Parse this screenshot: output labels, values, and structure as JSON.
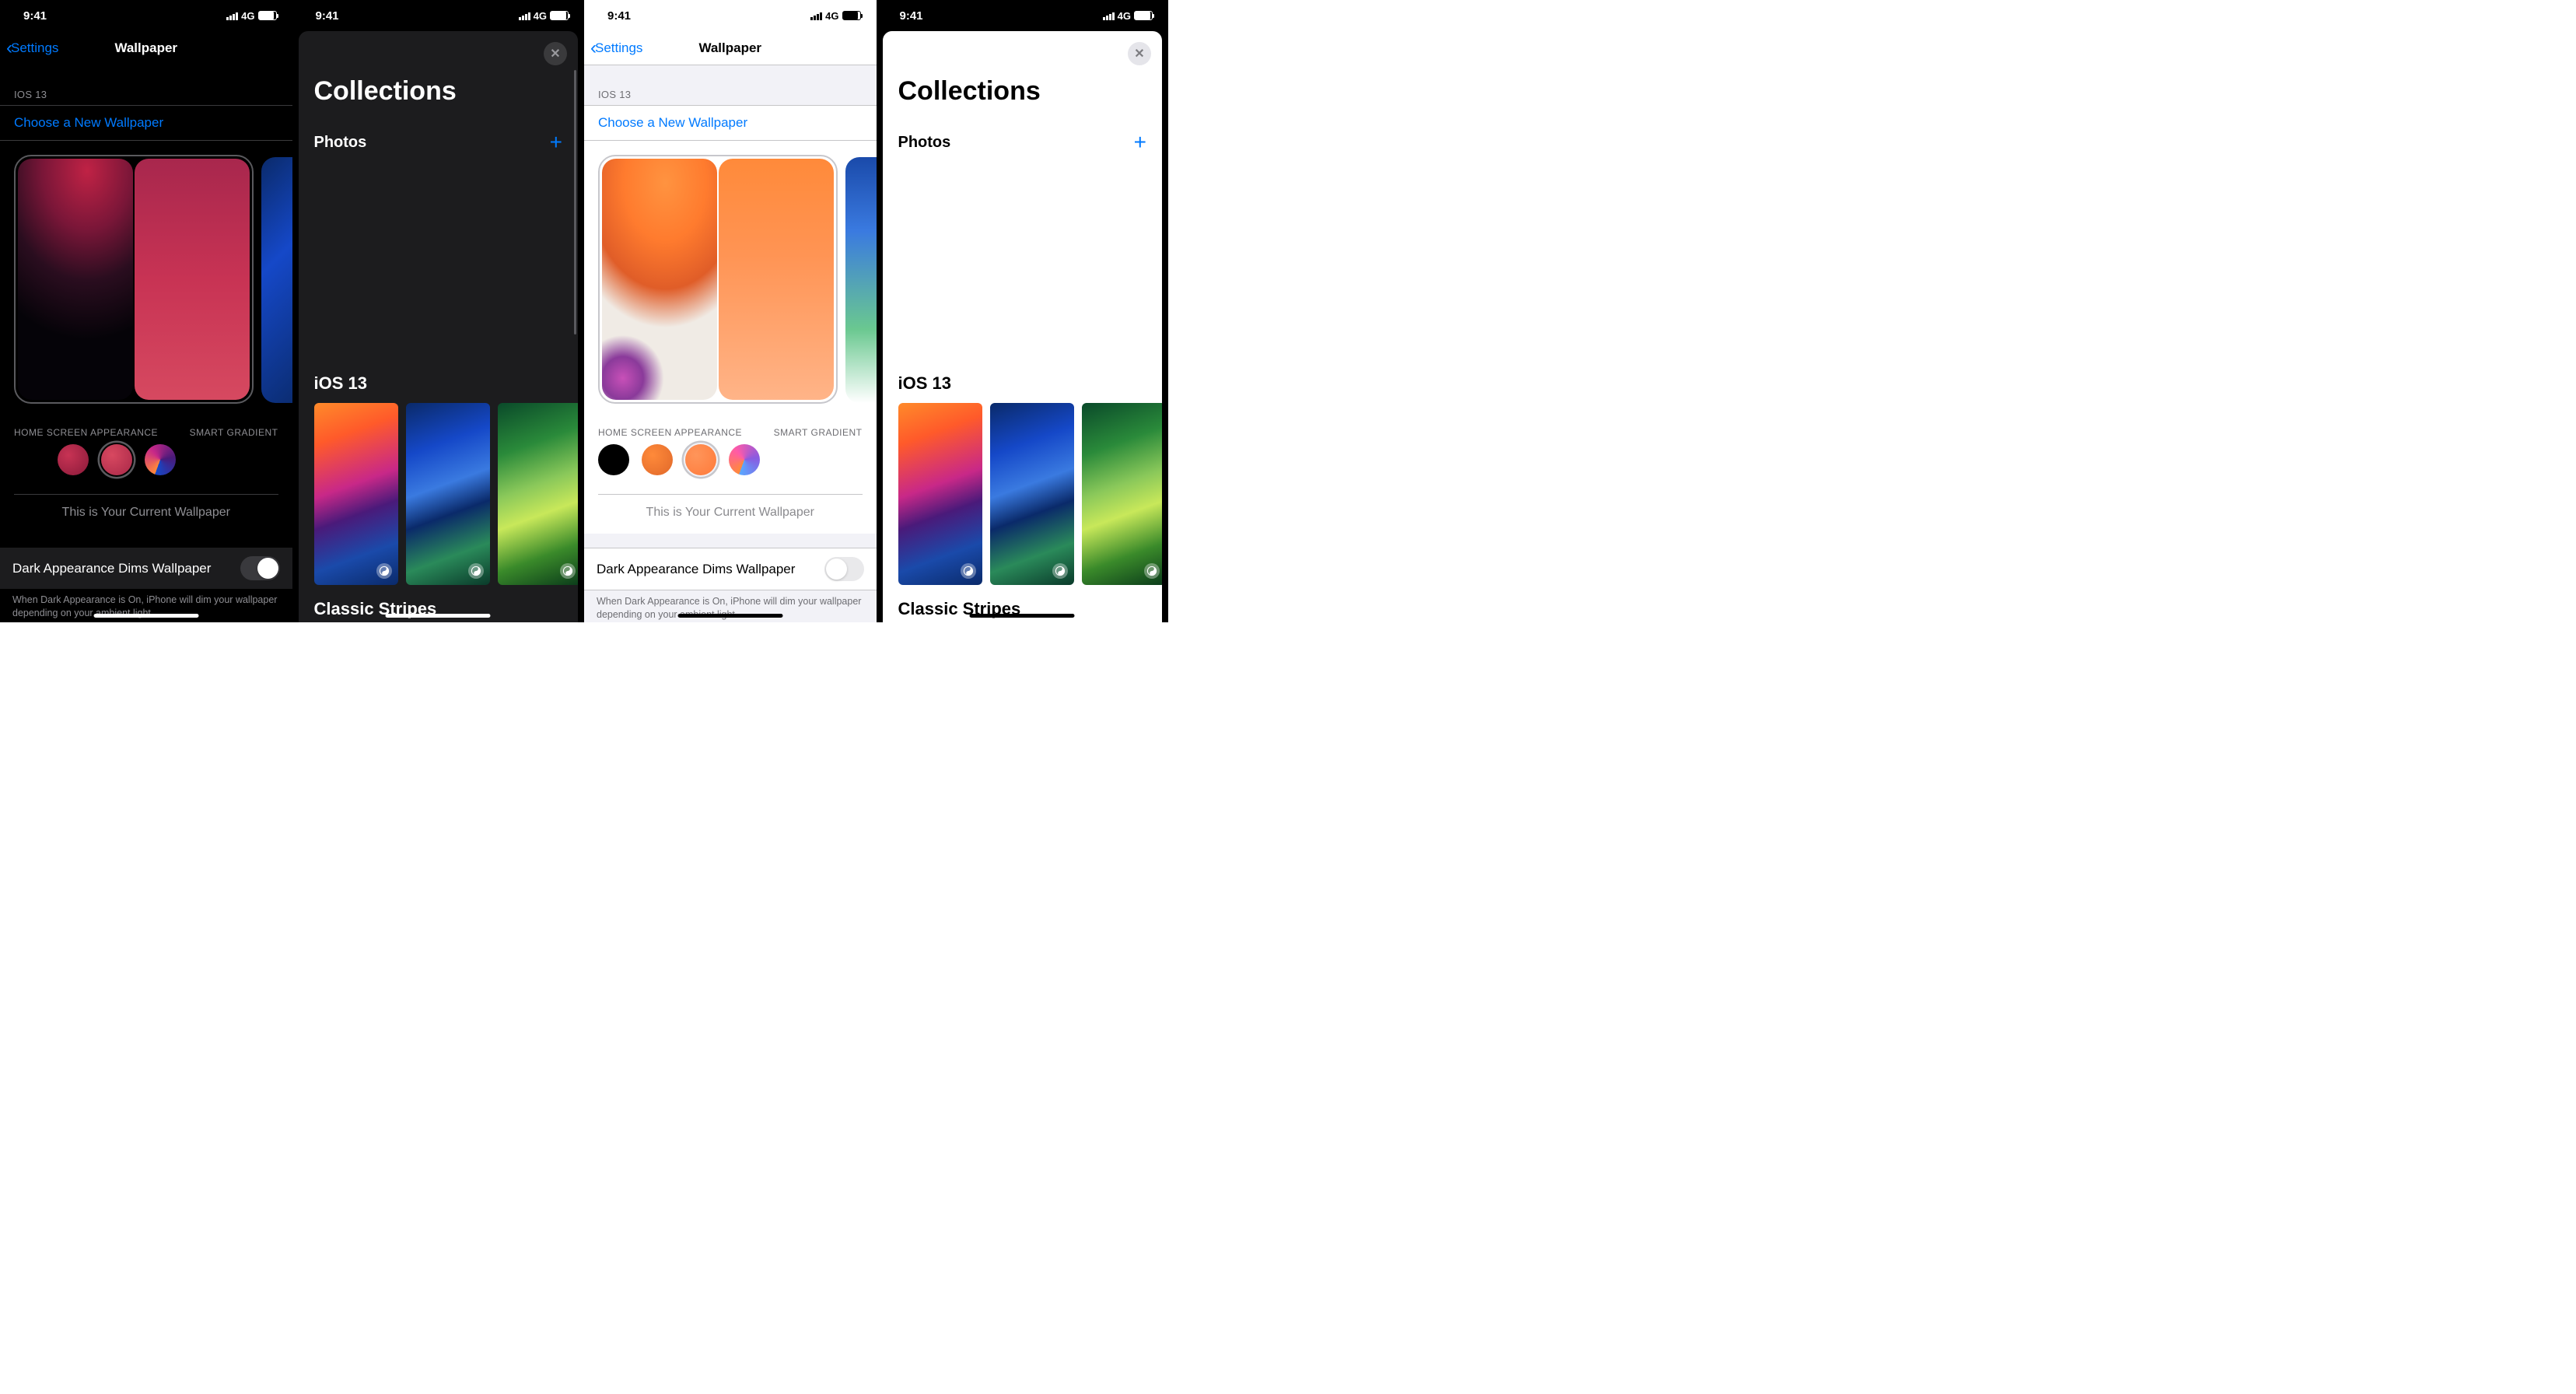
{
  "status": {
    "time": "9:41",
    "network": "4G"
  },
  "settings": {
    "back_label": "Settings",
    "title": "Wallpaper",
    "section_header": "IOS 13",
    "choose_link": "Choose a New Wallpaper",
    "appearance_header": "HOME SCREEN APPEARANCE",
    "smart_gradient": "SMART GRADIENT",
    "current_wallpaper": "This is Your Current Wallpaper",
    "dims_label": "Dark Appearance Dims Wallpaper",
    "dims_caption": "When Dark Appearance is On, iPhone will dim your wallpaper depending on your ambient light."
  },
  "collections": {
    "title": "Collections",
    "photos_label": "Photos",
    "ios13_label": "iOS 13",
    "classic_label": "Classic Stripes"
  }
}
